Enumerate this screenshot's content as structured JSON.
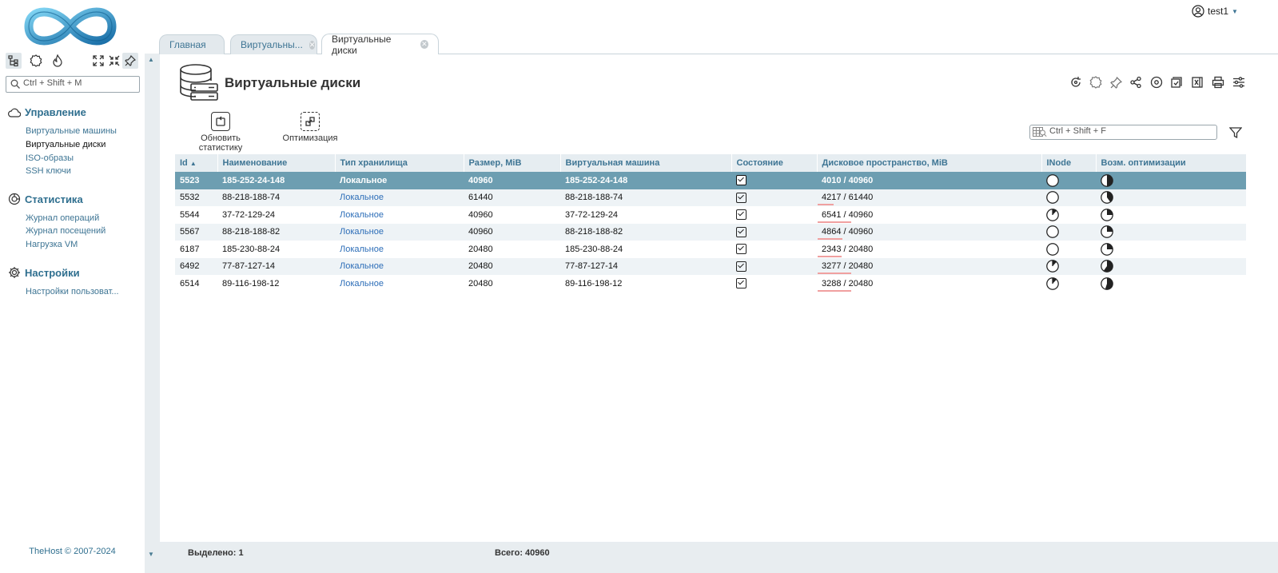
{
  "app": {
    "user": "test1",
    "copyright": "TheHost © 2007-2024"
  },
  "sidebar": {
    "search_placeholder": "Ctrl + Shift + M",
    "groups": [
      {
        "title": "Управление",
        "icon": "cloud-icon",
        "items": [
          "Виртуальные машины",
          "Виртуальные диски",
          "ISO-образы",
          "SSH ключи"
        ]
      },
      {
        "title": "Статистика",
        "icon": "chart-ring-icon",
        "items": [
          "Журнал операций",
          "Журнал посещений",
          "Нагрузка VM"
        ]
      },
      {
        "title": "Настройки",
        "icon": "gear-icon",
        "items": [
          "Настройки пользоват..."
        ]
      }
    ],
    "active_item": "Виртуальные диски"
  },
  "tabs": [
    {
      "label": "Главная",
      "closable": false,
      "active": false
    },
    {
      "label": "Виртуальны...",
      "closable": true,
      "active": false
    },
    {
      "label": "Виртуальные диски",
      "closable": true,
      "active": true
    }
  ],
  "page": {
    "title": "Виртуальные диски",
    "actions": [
      {
        "label": "Обновить статистику",
        "icon": "refresh-stats-icon"
      },
      {
        "label": "Оптимизация",
        "icon": "optimize-icon"
      }
    ],
    "filter_placeholder": "Ctrl + Shift + F"
  },
  "table": {
    "columns": [
      "Id",
      "Наименование",
      "Тип хранилища",
      "Размер, MiB",
      "Виртуальная машина",
      "Состояние",
      "Дисковое пространство, MiB",
      "INode",
      "Возм. оптимизации"
    ],
    "sort": {
      "column": "Id",
      "direction": "asc"
    },
    "rows": [
      {
        "id": "5523",
        "name": "185-252-24-148",
        "storage": "Локальное",
        "size": "40960",
        "vm": "185-252-24-148",
        "state": "on",
        "used": "4010",
        "total": "40960",
        "used_fraction": 0.098,
        "inode_fraction": 0.0,
        "opt_fraction": 0.5
      },
      {
        "id": "5532",
        "name": "88-218-188-74",
        "storage": "Локальное",
        "size": "61440",
        "vm": "88-218-188-74",
        "state": "on",
        "used": "4217",
        "total": "61440",
        "used_fraction": 0.069,
        "inode_fraction": 0.0,
        "opt_fraction": 0.4
      },
      {
        "id": "5544",
        "name": "37-72-129-24",
        "storage": "Локальное",
        "size": "40960",
        "vm": "37-72-129-24",
        "state": "on",
        "used": "6541",
        "total": "40960",
        "used_fraction": 0.16,
        "inode_fraction": 0.12,
        "opt_fraction": 0.25
      },
      {
        "id": "5567",
        "name": "88-218-188-82",
        "storage": "Локальное",
        "size": "40960",
        "vm": "88-218-188-82",
        "state": "on",
        "used": "4864",
        "total": "40960",
        "used_fraction": 0.119,
        "inode_fraction": 0.0,
        "opt_fraction": 0.25
      },
      {
        "id": "6187",
        "name": "185-230-88-24",
        "storage": "Локальное",
        "size": "20480",
        "vm": "185-230-88-24",
        "state": "on",
        "used": "2343",
        "total": "20480",
        "used_fraction": 0.114,
        "inode_fraction": 0.0,
        "opt_fraction": 0.25
      },
      {
        "id": "6492",
        "name": "77-87-127-14",
        "storage": "Локальное",
        "size": "20480",
        "vm": "77-87-127-14",
        "state": "on",
        "used": "3277",
        "total": "20480",
        "used_fraction": 0.16,
        "inode_fraction": 0.12,
        "opt_fraction": 0.6
      },
      {
        "id": "6514",
        "name": "89-116-198-12",
        "storage": "Локальное",
        "size": "20480",
        "vm": "89-116-198-12",
        "state": "on",
        "used": "3288",
        "total": "20480",
        "used_fraction": 0.161,
        "inode_fraction": 0.12,
        "opt_fraction": 0.55
      }
    ],
    "selected_index": 0
  },
  "footer": {
    "selected": "Выделено: 1",
    "total": "Всего: 40960"
  },
  "colors": {
    "accent": "#3e7594",
    "selected_row": "#6d9eb1",
    "header_bg": "#e6edf1",
    "usage_bar": "#f0a0a0"
  }
}
